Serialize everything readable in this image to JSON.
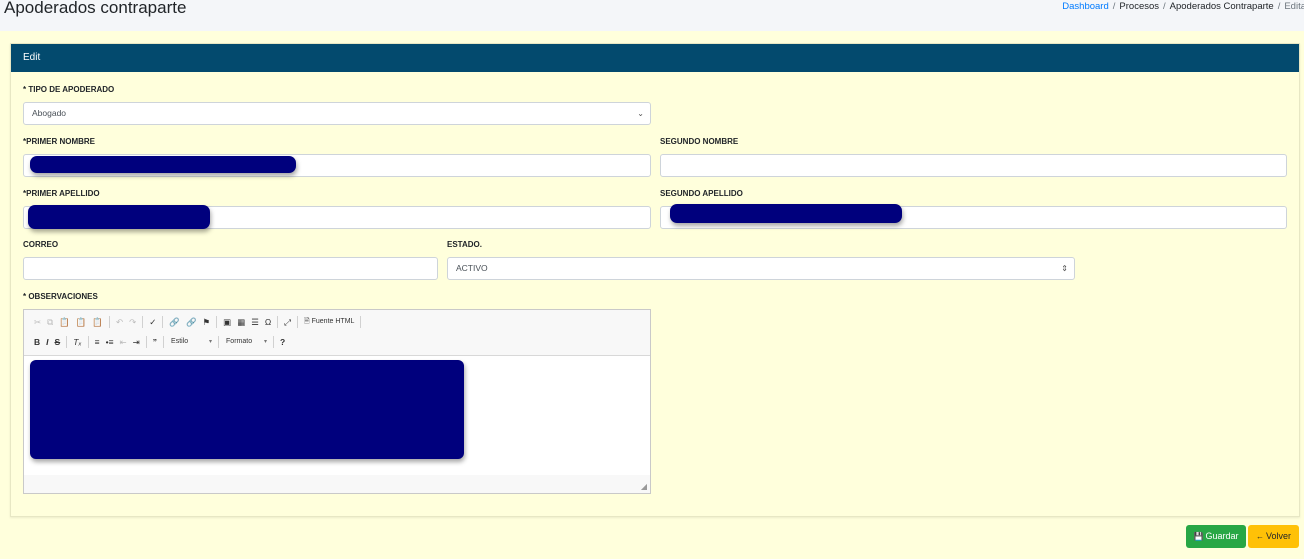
{
  "header": {
    "title": "Apoderados contraparte",
    "breadcrumb": [
      "Dashboard",
      "Procesos",
      "Apoderados Contraparte",
      "Edita"
    ]
  },
  "card": {
    "title": "Edit"
  },
  "form": {
    "tipo_label": "* TIPO DE APODERADO",
    "tipo_value": "Abogado",
    "primer_nombre_label": "*PRIMER NOMBRE",
    "segundo_nombre_label": "SEGUNDO NOMBRE",
    "primer_apellido_label": "*PRIMER APELLIDO",
    "segundo_apellido_label": "SEGUNDO APELLIDO",
    "correo_label": "CORREO",
    "estado_label": "ESTADO.",
    "estado_value": "ACTIVO",
    "observaciones_label": "* OBSERVACIONES"
  },
  "editor": {
    "source_label": "Fuente HTML",
    "style_combo": "Estilo",
    "format_combo": "Formato"
  },
  "actions": {
    "save_label": "Guardar",
    "back_label": "Volver"
  },
  "colors": {
    "header_bg": "#034a6e",
    "page_bg": "#ffffdc",
    "save": "#28a745",
    "back": "#ffc107",
    "redaction": "#00007d"
  }
}
